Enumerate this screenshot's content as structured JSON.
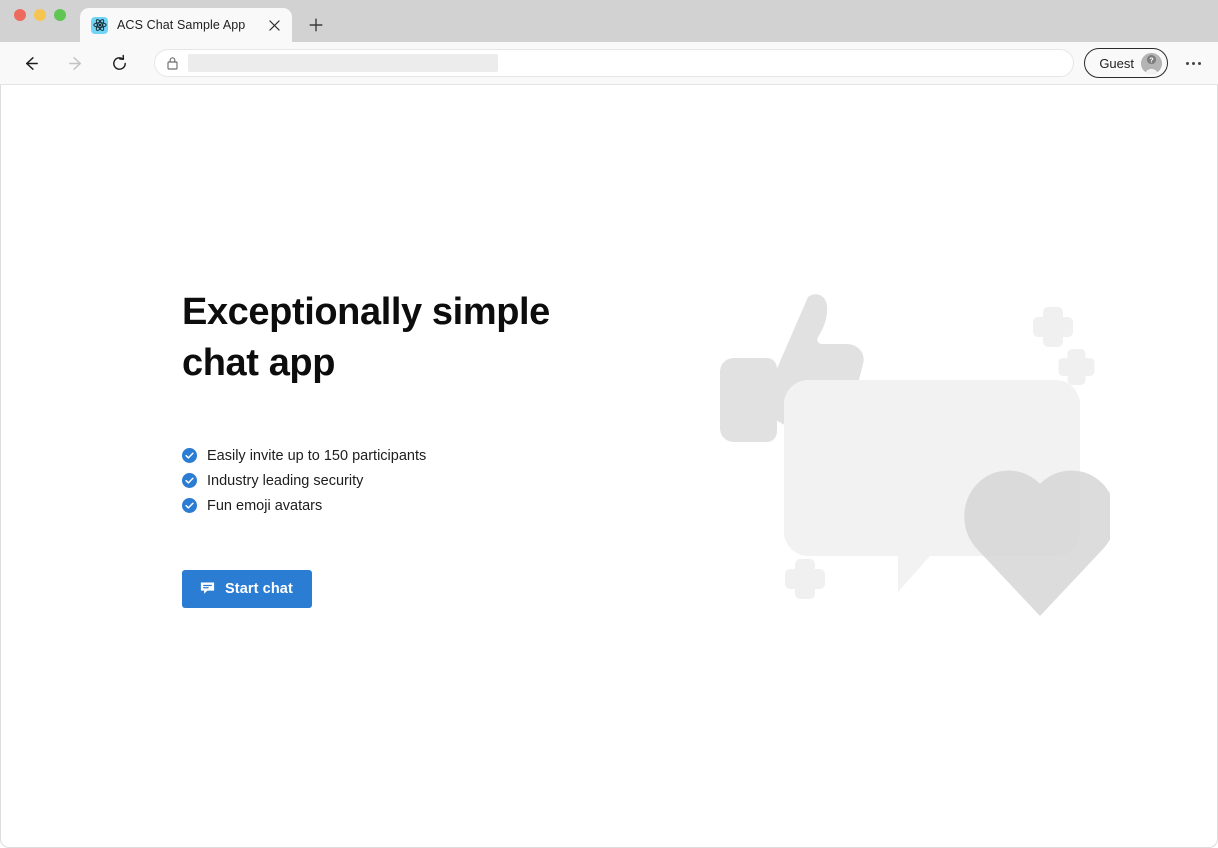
{
  "browser": {
    "window_controls": [
      {
        "name": "close",
        "color": "#ed6a5e"
      },
      {
        "name": "minimize",
        "color": "#f5c451"
      },
      {
        "name": "maximize",
        "color": "#61c554"
      }
    ],
    "tab": {
      "title": "ACS Chat Sample App",
      "favicon_name": "react-logo-icon",
      "favicon_bg": "#6fd4f5",
      "close_label": "×"
    },
    "new_tab_label": "+",
    "toolbar": {
      "back_label": "Back",
      "forward_label": "Forward",
      "reload_label": "Reload",
      "back_enabled": true,
      "forward_enabled": false,
      "omnibox": {
        "lock_icon": "lock-icon",
        "value": "",
        "placeholder": "",
        "url_redacted": true
      },
      "profile": {
        "label": "Guest",
        "avatar_icon": "person-question-avatar-icon"
      },
      "more_label": "…"
    }
  },
  "page": {
    "title_line1": "Exceptionally simple",
    "title_line2": "chat app",
    "features": [
      {
        "label": "Easily invite up to 150 participants",
        "icon": "check-circle-icon"
      },
      {
        "label": "Industry leading security",
        "icon": "check-circle-icon"
      },
      {
        "label": "Fun emoji avatars",
        "icon": "check-circle-icon"
      }
    ],
    "start_chat": {
      "label": "Start chat",
      "icon": "chat-bubble-icon",
      "color": "#2b7cd3"
    },
    "illustration": {
      "name": "chat-reactions-illustration",
      "shapes": [
        "thumbs-up",
        "speech-bubble",
        "heart",
        "sparkle-plus"
      ],
      "colors": {
        "thumb": "#e3e3e3",
        "bubble": "#f2f2f2",
        "heart": "#d6d6d6",
        "sparkle": "#f0f0f0"
      }
    }
  }
}
